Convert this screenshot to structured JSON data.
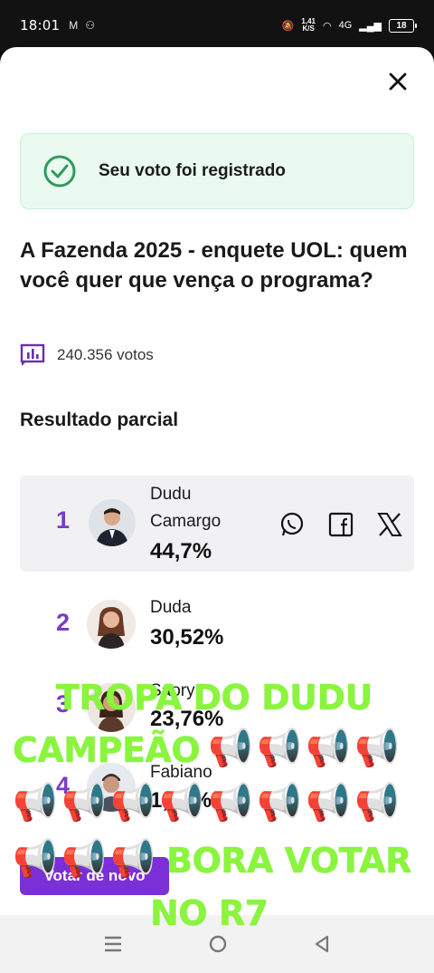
{
  "status_bar": {
    "time": "18:01",
    "left_icons": [
      "gmail-icon",
      "app-icon"
    ],
    "speed": "1,41\nK/S",
    "network": "4G",
    "battery": "18"
  },
  "toast": {
    "text": "Seu voto foi registrado",
    "icon": "check-circle-icon"
  },
  "question": "A Fazenda 2025 - enquete UOL: quem você quer que vença o programa?",
  "votes": {
    "icon": "poll-icon",
    "text": "240.356 votos"
  },
  "result_title": "Resultado parcial",
  "results": [
    {
      "rank": "1",
      "name": "Dudu Camargo",
      "pct": "44,7%"
    },
    {
      "rank": "2",
      "name": "Duda",
      "pct": "30,52%"
    },
    {
      "rank": "3",
      "name": "Saory",
      "pct": "23,76%"
    },
    {
      "rank": "4",
      "name": "Fabiano",
      "pct": "1,04%"
    }
  ],
  "share": [
    "whatsapp-icon",
    "facebook-icon",
    "x-icon"
  ],
  "cta_label": "Votar de novo",
  "overlay": {
    "line1": "TROPA DO DUDU",
    "line2": "CAMPEÃO",
    "line3": "BORA VOTAR",
    "line4": "NO R7",
    "emoji": "📢"
  },
  "colors": {
    "accent": "#7b2fd6",
    "rank": "#7a3cc6",
    "success": "#2e9c5a",
    "overlay_text": "#89f53c"
  }
}
